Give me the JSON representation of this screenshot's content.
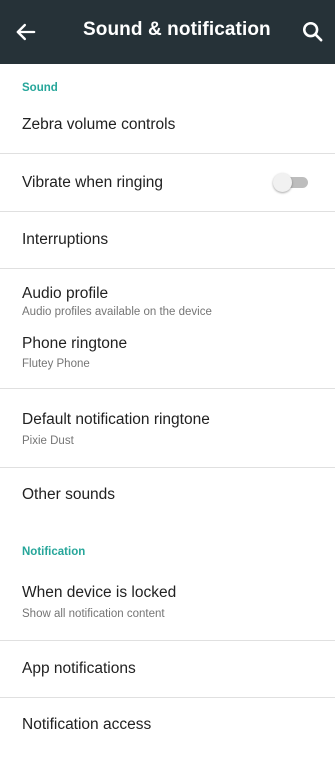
{
  "appbar": {
    "title": "Sound & notification",
    "back_icon": "arrow-back-icon",
    "search_icon": "search-icon"
  },
  "sections": {
    "sound_header": "Sound",
    "notification_header": "Notification"
  },
  "items": {
    "zebra_volume": {
      "title": "Zebra volume controls"
    },
    "vibrate": {
      "title": "Vibrate when ringing",
      "toggle_on": false
    },
    "interruptions": {
      "title": "Interruptions"
    },
    "audio_profile": {
      "title": "Audio profile",
      "summary": "Audio profiles available on the device"
    },
    "phone_ringtone": {
      "title": "Phone ringtone",
      "summary": "Flutey Phone"
    },
    "default_notification": {
      "title": "Default notification ringtone",
      "summary": "Pixie Dust"
    },
    "other_sounds": {
      "title": "Other sounds"
    },
    "when_locked": {
      "title": "When device is locked",
      "summary": "Show all notification content"
    },
    "app_notifications": {
      "title": "App notifications"
    },
    "notification_access": {
      "title": "Notification access"
    }
  },
  "colors": {
    "appbar": "#263238",
    "accent": "#26a69a",
    "divider": "#e0e0e0"
  }
}
